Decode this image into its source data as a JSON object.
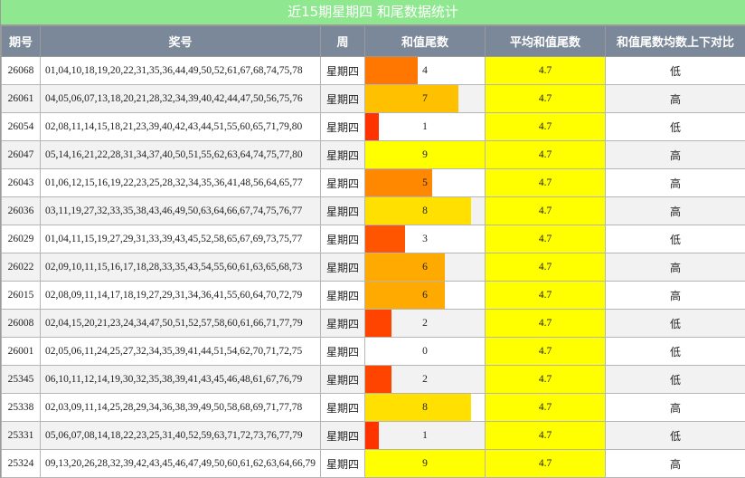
{
  "title": "近15期星期四 和尾数据统计",
  "headers": {
    "period": "期号",
    "numbers": "奖号",
    "weekday": "周",
    "tail": "和值尾数",
    "avg": "平均和值尾数",
    "compare": "和值尾数均数上下对比"
  },
  "colors": {
    "title_bg": "#8fe88f",
    "header_bg": "#7a8899",
    "avg_bg": "#ffff00",
    "tail_0": "#ffffff",
    "tail_1": "#ff3300",
    "tail_2": "#ff4400",
    "tail_3": "#ff5500",
    "tail_4": "#ff7700",
    "tail_5": "#ff8800",
    "tail_6": "#ffaa00",
    "tail_7": "#ffc000",
    "tail_8": "#ffe000",
    "tail_9": "#ffff00"
  },
  "rows": [
    {
      "period": "26068",
      "numbers": "01,04,10,18,19,20,22,31,35,36,44,49,50,52,61,67,68,74,75,78",
      "weekday": "星期四",
      "tail": "4",
      "tail_fraction": 0.44,
      "avg": "4.7",
      "compare": "低"
    },
    {
      "period": "26061",
      "numbers": "04,05,06,07,13,18,20,21,28,32,34,39,40,42,44,47,50,56,75,76",
      "weekday": "星期四",
      "tail": "7",
      "tail_fraction": 0.78,
      "avg": "4.7",
      "compare": "高"
    },
    {
      "period": "26054",
      "numbers": "02,08,11,14,15,18,21,23,39,40,42,43,44,51,55,60,65,71,79,80",
      "weekday": "星期四",
      "tail": "1",
      "tail_fraction": 0.11,
      "avg": "4.7",
      "compare": "低"
    },
    {
      "period": "26047",
      "numbers": "05,14,16,21,22,28,31,34,37,40,50,51,55,62,63,64,74,75,77,80",
      "weekday": "星期四",
      "tail": "9",
      "tail_fraction": 1.0,
      "avg": "4.7",
      "compare": "高"
    },
    {
      "period": "26043",
      "numbers": "01,06,12,15,16,19,22,23,25,28,32,34,35,36,41,48,56,64,65,77",
      "weekday": "星期四",
      "tail": "5",
      "tail_fraction": 0.56,
      "avg": "4.7",
      "compare": "高"
    },
    {
      "period": "26036",
      "numbers": "03,11,19,27,32,33,35,38,43,46,49,50,63,64,66,67,74,75,76,77",
      "weekday": "星期四",
      "tail": "8",
      "tail_fraction": 0.89,
      "avg": "4.7",
      "compare": "高"
    },
    {
      "period": "26029",
      "numbers": "01,04,11,15,19,27,29,31,33,39,43,45,52,58,65,67,69,73,75,77",
      "weekday": "星期四",
      "tail": "3",
      "tail_fraction": 0.33,
      "avg": "4.7",
      "compare": "低"
    },
    {
      "period": "26022",
      "numbers": "02,09,10,11,15,16,17,18,28,33,35,43,54,55,60,61,63,65,68,73",
      "weekday": "星期四",
      "tail": "6",
      "tail_fraction": 0.67,
      "avg": "4.7",
      "compare": "高"
    },
    {
      "period": "26015",
      "numbers": "02,08,09,11,14,17,18,19,27,29,31,34,36,41,55,60,64,70,72,79",
      "weekday": "星期四",
      "tail": "6",
      "tail_fraction": 0.67,
      "avg": "4.7",
      "compare": "高"
    },
    {
      "period": "26008",
      "numbers": "02,04,15,20,21,23,24,34,47,50,51,52,57,58,60,61,66,71,77,79",
      "weekday": "星期四",
      "tail": "2",
      "tail_fraction": 0.22,
      "avg": "4.7",
      "compare": "低"
    },
    {
      "period": "26001",
      "numbers": "02,05,06,11,24,25,27,32,34,35,39,41,44,51,54,62,70,71,72,75",
      "weekday": "星期四",
      "tail": "0",
      "tail_fraction": 0.0,
      "avg": "4.7",
      "compare": "低"
    },
    {
      "period": "25345",
      "numbers": "06,10,11,12,14,19,30,32,35,38,39,41,43,45,46,48,61,67,76,79",
      "weekday": "星期四",
      "tail": "2",
      "tail_fraction": 0.22,
      "avg": "4.7",
      "compare": "低"
    },
    {
      "period": "25338",
      "numbers": "02,03,09,11,14,25,28,29,34,36,38,39,49,50,58,68,69,71,77,78",
      "weekday": "星期四",
      "tail": "8",
      "tail_fraction": 0.89,
      "avg": "4.7",
      "compare": "高"
    },
    {
      "period": "25331",
      "numbers": "05,06,07,08,14,18,22,23,25,31,40,52,59,63,71,72,73,76,77,79",
      "weekday": "星期四",
      "tail": "1",
      "tail_fraction": 0.11,
      "avg": "4.7",
      "compare": "低"
    },
    {
      "period": "25324",
      "numbers": "09,13,20,26,28,32,39,42,43,45,46,47,49,50,60,61,62,63,64,66,79",
      "weekday": "星期四",
      "tail": "9",
      "tail_fraction": 1.0,
      "avg": "4.7",
      "compare": "高"
    }
  ]
}
